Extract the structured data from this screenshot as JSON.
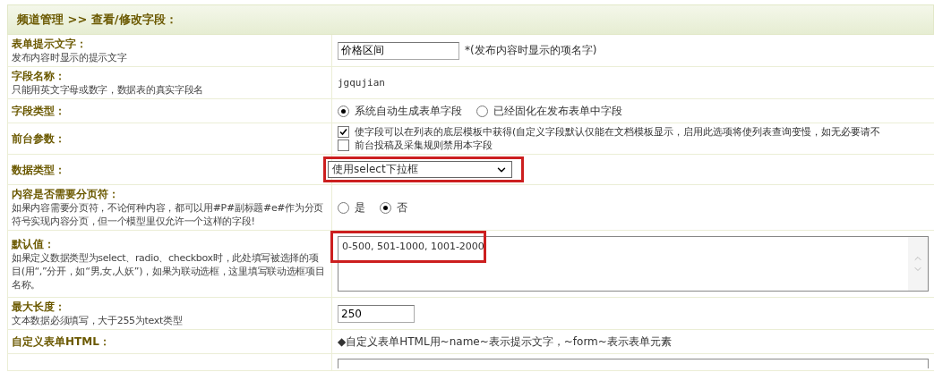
{
  "header": {
    "title": "频道管理 >> 查看/修改字段："
  },
  "rows": [
    {
      "kind": "input",
      "label": "表单提示文字：",
      "hint": "发布内容时显示的提示文字",
      "value": "价格区间",
      "note": "*(发布内容时显示的项名字)"
    },
    {
      "kind": "text",
      "label": "字段名称：",
      "hint": "只能用英文字母或数字，数据表的真实字段名",
      "value": "jgqujian"
    },
    {
      "kind": "radios",
      "label": "字段类型：",
      "options": [
        {
          "label": "系统自动生成表单字段",
          "selected": true
        },
        {
          "label": "已经固化在发布表单中字段",
          "selected": false
        }
      ]
    },
    {
      "kind": "checks",
      "label": "前台参数：",
      "options": [
        {
          "label": "使字段可以在列表的底层模板中获得(自定义字段默认仅能在文档模板显示，启用此选项将使列表查询变慢，如无必要请不",
          "checked": true
        },
        {
          "label": "前台投稿及采集规则禁用本字段",
          "checked": false
        }
      ]
    },
    {
      "kind": "select",
      "label": "数据类型：",
      "value": "使用select下拉框",
      "highlighted": true
    },
    {
      "kind": "radios",
      "label": "内容是否需要分页符：",
      "hint": "如果内容需要分页符，不论何种内容，都可以用#P#副标题#e#作为分页符号实现内容分页，但一个模型里仅允许一个这样的字段!",
      "options": [
        {
          "label": "是",
          "selected": false
        },
        {
          "label": "否",
          "selected": true
        }
      ]
    },
    {
      "kind": "textarea",
      "label": "默认值：",
      "hint": "如果定义数据类型为select、radio、checkbox时，此处填写被选择的项目(用“,”分开，如“男,女,人妖”)，如果为联动选框，这里填写联动选框项目名称。",
      "value": "0-500, 501-1000, 1001-2000",
      "highlighted": true
    },
    {
      "kind": "input",
      "label": "最大长度：",
      "hint": "文本数据必须填写，大于255为text类型",
      "value": "250"
    },
    {
      "kind": "text",
      "label": "自定义表单HTML：",
      "value": "◆自定义表单HTML用~name~表示提示文字，~form~表示表单元素"
    },
    {
      "kind": "blank"
    }
  ]
}
